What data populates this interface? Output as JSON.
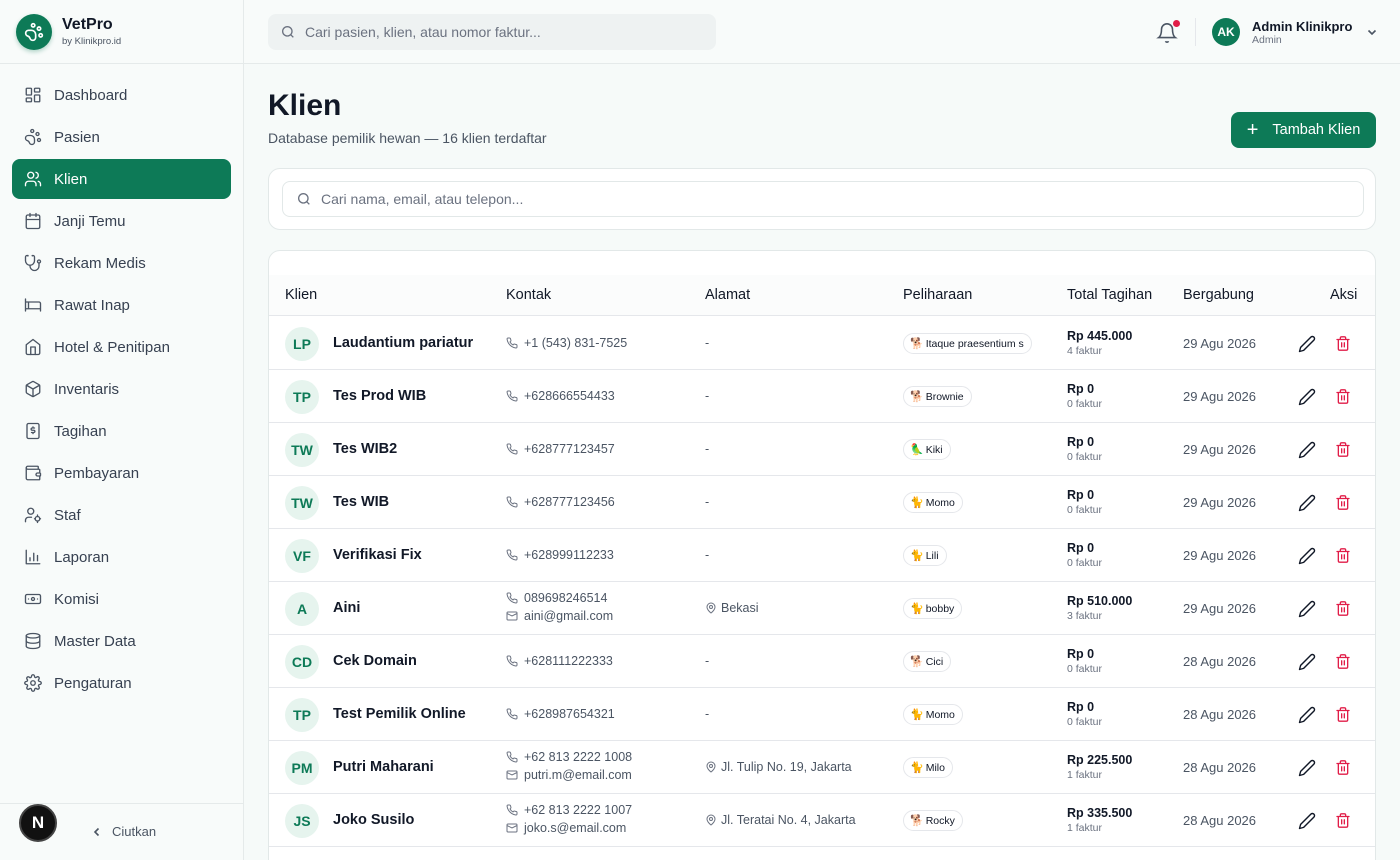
{
  "brand": {
    "name": "VetPro",
    "sub": "by Klinikpro.id"
  },
  "nav": [
    {
      "label": "Dashboard",
      "icon": "grid-icon"
    },
    {
      "label": "Pasien",
      "icon": "paw-icon"
    },
    {
      "label": "Klien",
      "icon": "users-icon",
      "active": true
    },
    {
      "label": "Janji Temu",
      "icon": "calendar-icon"
    },
    {
      "label": "Rekam Medis",
      "icon": "stethoscope-icon"
    },
    {
      "label": "Rawat Inap",
      "icon": "bed-icon"
    },
    {
      "label": "Hotel & Penitipan",
      "icon": "home-icon"
    },
    {
      "label": "Inventaris",
      "icon": "box-icon"
    },
    {
      "label": "Tagihan",
      "icon": "invoice-icon"
    },
    {
      "label": "Pembayaran",
      "icon": "wallet-icon"
    },
    {
      "label": "Staf",
      "icon": "user-cog-icon"
    },
    {
      "label": "Laporan",
      "icon": "chart-icon"
    },
    {
      "label": "Komisi",
      "icon": "banknote-icon"
    },
    {
      "label": "Master Data",
      "icon": "database-icon"
    },
    {
      "label": "Pengaturan",
      "icon": "gear-icon"
    }
  ],
  "footer": {
    "badge": "N",
    "collapse_label": "Ciutkan"
  },
  "header": {
    "search_placeholder": "Cari pasien, klien, atau nomor faktur...",
    "user_initials": "AK",
    "user_name": "Admin Klinikpro",
    "user_role": "Admin"
  },
  "page": {
    "title": "Klien",
    "subtitle": "Database pemilik hewan — 16 klien terdaftar",
    "add_label": "Tambah Klien",
    "search_placeholder": "Cari nama, email, atau telepon..."
  },
  "table": {
    "columns": [
      "Klien",
      "Kontak",
      "Alamat",
      "Peliharaan",
      "Total Tagihan",
      "Bergabung",
      "Aksi"
    ],
    "rows": [
      {
        "initials": "LP",
        "name": "Laudantium pariatur",
        "phone": "+1 (543) 831-7525",
        "email": "",
        "address": "-",
        "pet_emoji": "🐕",
        "pet": "Itaque praesentium s",
        "total": "Rp 445.000",
        "invoices": "4 faktur",
        "joined": "29 Agu 2026"
      },
      {
        "initials": "TP",
        "name": "Tes Prod WIB",
        "phone": "+628666554433",
        "email": "",
        "address": "-",
        "pet_emoji": "🐕",
        "pet": "Brownie",
        "total": "Rp 0",
        "invoices": "0 faktur",
        "joined": "29 Agu 2026"
      },
      {
        "initials": "TW",
        "name": "Tes WIB2",
        "phone": "+628777123457",
        "email": "",
        "address": "-",
        "pet_emoji": "🦜",
        "pet": "Kiki",
        "total": "Rp 0",
        "invoices": "0 faktur",
        "joined": "29 Agu 2026"
      },
      {
        "initials": "TW",
        "name": "Tes WIB",
        "phone": "+628777123456",
        "email": "",
        "address": "-",
        "pet_emoji": "🐈",
        "pet": "Momo",
        "total": "Rp 0",
        "invoices": "0 faktur",
        "joined": "29 Agu 2026"
      },
      {
        "initials": "VF",
        "name": "Verifikasi Fix",
        "phone": "+628999112233",
        "email": "",
        "address": "-",
        "pet_emoji": "🐈",
        "pet": "Lili",
        "total": "Rp 0",
        "invoices": "0 faktur",
        "joined": "29 Agu 2026"
      },
      {
        "initials": "A",
        "name": "Aini",
        "phone": "089698246514",
        "email": "aini@gmail.com",
        "address": "Bekasi",
        "pet_emoji": "🐈",
        "pet": "bobby",
        "total": "Rp 510.000",
        "invoices": "3 faktur",
        "joined": "29 Agu 2026"
      },
      {
        "initials": "CD",
        "name": "Cek Domain",
        "phone": "+628111222333",
        "email": "",
        "address": "-",
        "pet_emoji": "🐕",
        "pet": "Cici",
        "total": "Rp 0",
        "invoices": "0 faktur",
        "joined": "28 Agu 2026"
      },
      {
        "initials": "TP",
        "name": "Test Pemilik Online",
        "phone": "+628987654321",
        "email": "",
        "address": "-",
        "pet_emoji": "🐈",
        "pet": "Momo",
        "total": "Rp 0",
        "invoices": "0 faktur",
        "joined": "28 Agu 2026"
      },
      {
        "initials": "PM",
        "name": "Putri Maharani",
        "phone": "+62 813 2222 1008",
        "email": "putri.m@email.com",
        "address": "Jl. Tulip No. 19, Jakarta",
        "pet_emoji": "🐈",
        "pet": "Milo",
        "total": "Rp 225.500",
        "invoices": "1 faktur",
        "joined": "28 Agu 2026"
      },
      {
        "initials": "JS",
        "name": "Joko Susilo",
        "phone": "+62 813 2222 1007",
        "email": "joko.s@email.com",
        "address": "Jl. Teratai No. 4, Jakarta",
        "pet_emoji": "🐕",
        "pet": "Rocky",
        "total": "Rp 335.500",
        "invoices": "1 faktur",
        "joined": "28 Agu 2026"
      }
    ]
  },
  "colors": {
    "primary": "#0d7a57",
    "danger": "#e11d48",
    "avatar_bg": "#e6f4ee"
  }
}
